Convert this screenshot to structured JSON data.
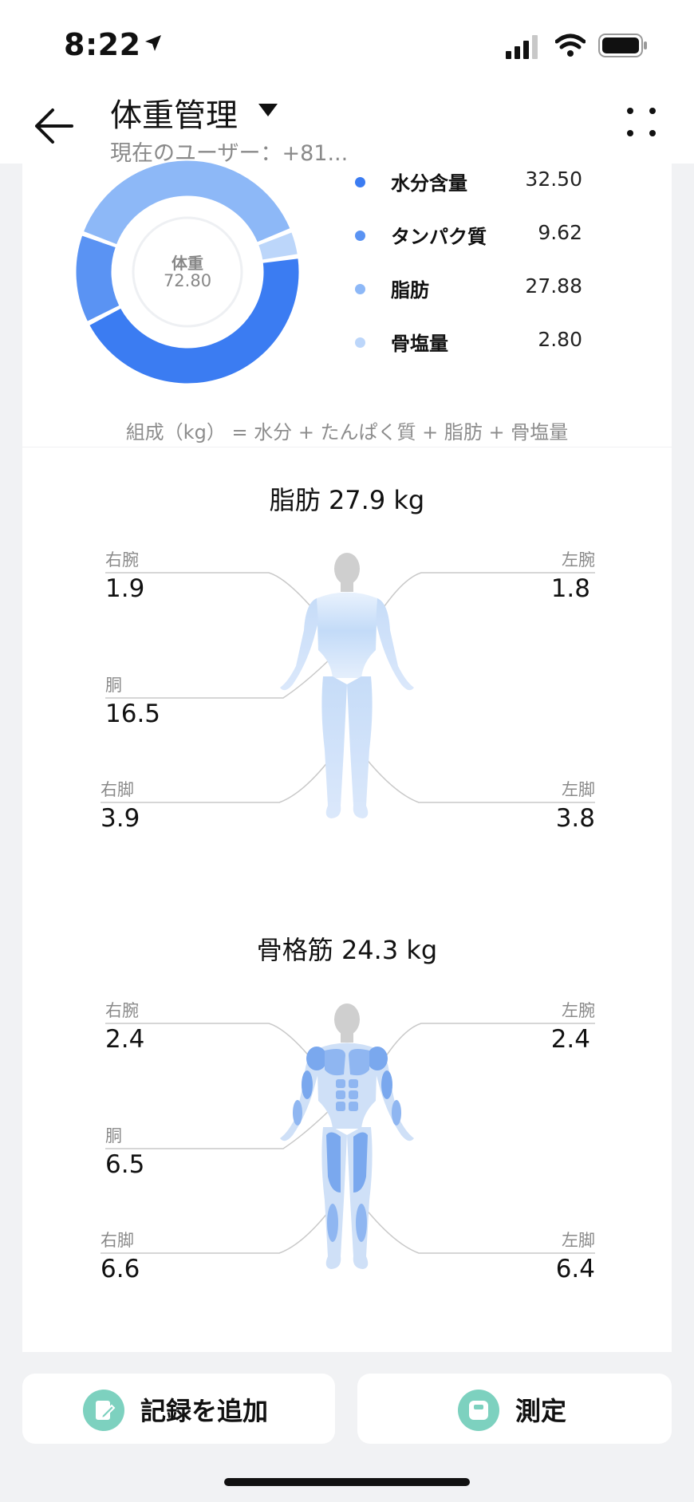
{
  "status_bar": {
    "time": "8:22"
  },
  "header": {
    "title": "体重管理",
    "subtitle": "現在のユーザー：+81..."
  },
  "donut": {
    "center_label": "体重",
    "center_value": "72.80",
    "legend": [
      {
        "label": "水分含量",
        "value": "32.50",
        "color": "#3b7cf2"
      },
      {
        "label": "タンパク質",
        "value": "9.62",
        "color": "#5a93f3"
      },
      {
        "label": "脂肪",
        "value": "27.88",
        "color": "#8db8f7"
      },
      {
        "label": "骨塩量",
        "value": "2.80",
        "color": "#bcd6fa"
      }
    ],
    "formula": "組成（kg） = 水分 + たんぱく質 + 脂肪 + 骨塩量"
  },
  "fat": {
    "title": "脂肪 27.9 kg",
    "right_arm_label": "右腕",
    "right_arm_value": "1.9",
    "left_arm_label": "左腕",
    "left_arm_value": "1.8",
    "trunk_label": "胴",
    "trunk_value": "16.5",
    "right_leg_label": "右脚",
    "right_leg_value": "3.9",
    "left_leg_label": "左脚",
    "left_leg_value": "3.8"
  },
  "muscle": {
    "title": "骨格筋 24.3 kg",
    "right_arm_label": "右腕",
    "right_arm_value": "2.4",
    "left_arm_label": "左腕",
    "left_arm_value": "2.4",
    "trunk_label": "胴",
    "trunk_value": "6.5",
    "right_leg_label": "右脚",
    "right_leg_value": "6.6",
    "left_leg_label": "左脚",
    "left_leg_value": "6.4"
  },
  "buttons": {
    "add_record": "記録を追加",
    "measure": "測定"
  }
}
